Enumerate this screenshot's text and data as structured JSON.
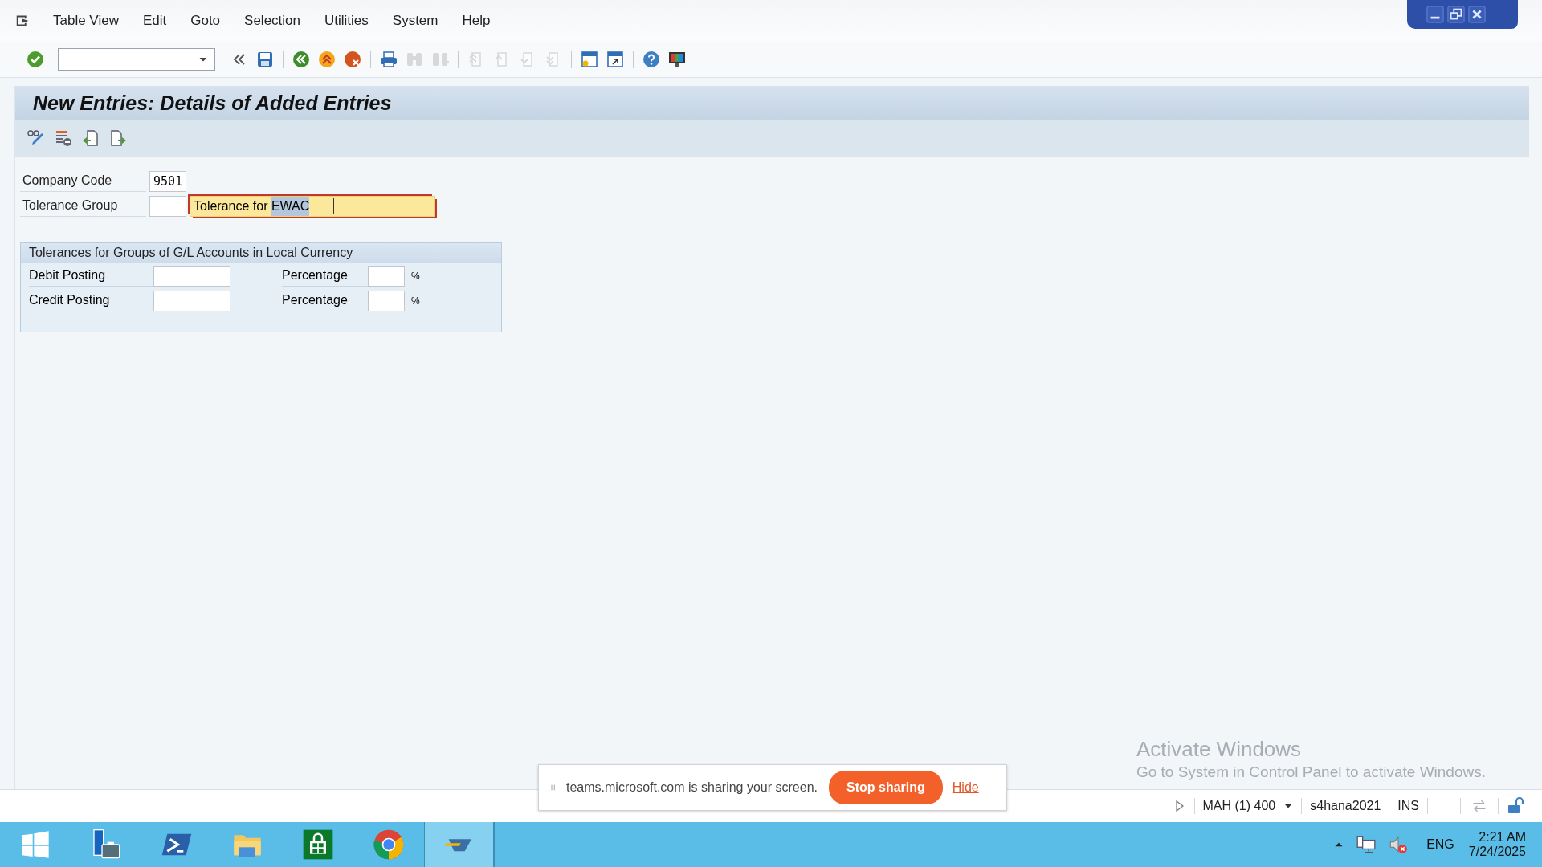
{
  "menu_bar": {
    "items": [
      {
        "label": "Table View"
      },
      {
        "label": "Edit"
      },
      {
        "label": "Goto"
      },
      {
        "label": "Selection"
      },
      {
        "label": "Utilities"
      },
      {
        "label": "System"
      },
      {
        "label": "Help"
      }
    ]
  },
  "toolbar": {
    "items": [
      {
        "kind": "enter",
        "disabled": false
      },
      {
        "kind": "command-field"
      },
      {
        "kind": "collapse",
        "disabled": false
      },
      {
        "kind": "save",
        "disabled": false
      },
      {
        "kind": "separator"
      },
      {
        "kind": "back",
        "disabled": false
      },
      {
        "kind": "exit",
        "disabled": false
      },
      {
        "kind": "cancel",
        "disabled": false
      },
      {
        "kind": "separator"
      },
      {
        "kind": "print",
        "disabled": false
      },
      {
        "kind": "find",
        "disabled": true
      },
      {
        "kind": "find-next",
        "disabled": true
      },
      {
        "kind": "separator"
      },
      {
        "kind": "first-page",
        "disabled": true
      },
      {
        "kind": "previous-page",
        "disabled": true
      },
      {
        "kind": "next-page",
        "disabled": true
      },
      {
        "kind": "last-page",
        "disabled": true
      },
      {
        "kind": "separator"
      },
      {
        "kind": "new-session",
        "disabled": false
      },
      {
        "kind": "shortcut",
        "disabled": false
      },
      {
        "kind": "separator"
      },
      {
        "kind": "help",
        "disabled": false
      },
      {
        "kind": "customize",
        "disabled": false
      }
    ]
  },
  "screen": {
    "title": "New Entries: Details of Added Entries",
    "app_toolbar": [
      {
        "kind": "display-change"
      },
      {
        "kind": "delete-row"
      },
      {
        "kind": "previous-entry"
      },
      {
        "kind": "next-entry"
      }
    ],
    "header_fields": [
      {
        "kind": "text",
        "label": "Company Code",
        "value": "9501"
      },
      {
        "kind": "key-with-description",
        "label": "Tolerance Group",
        "description": {
          "focused": true,
          "parts": [
            {
              "text": "Tolerance for ",
              "selected": false
            },
            {
              "text": "EWAC",
              "selected": true
            }
          ]
        }
      }
    ],
    "group": {
      "title": "Tolerances for Groups of G/L Accounts in Local Currency",
      "rows": [
        {
          "label": "Debit Posting",
          "percent_label": "Percentage",
          "unit": "%"
        },
        {
          "label": "Credit Posting",
          "percent_label": "Percentage",
          "unit": "%"
        }
      ]
    }
  },
  "activation_notice": {
    "title": "Activate Windows",
    "text": "Go to System in Control Panel to activate Windows."
  },
  "sharing_bar": {
    "message": "teams.microsoft.com is sharing your screen.",
    "stop_button": "Stop sharing",
    "hide_link": "Hide"
  },
  "status_bar": {
    "system": "MAH (1) 400",
    "server": "s4hana2021",
    "mode": "INS"
  },
  "taskbar": {
    "apps": [
      {
        "kind": "start",
        "selected": false
      },
      {
        "kind": "server-manager",
        "selected": false
      },
      {
        "kind": "powershell",
        "selected": false
      },
      {
        "kind": "explorer",
        "selected": false
      },
      {
        "kind": "store",
        "selected": false
      },
      {
        "kind": "chrome",
        "selected": false
      },
      {
        "kind": "sap",
        "selected": true
      }
    ],
    "tray": {
      "language": "ENG",
      "time": "2:21 AM",
      "date": "7/24/2025"
    }
  }
}
